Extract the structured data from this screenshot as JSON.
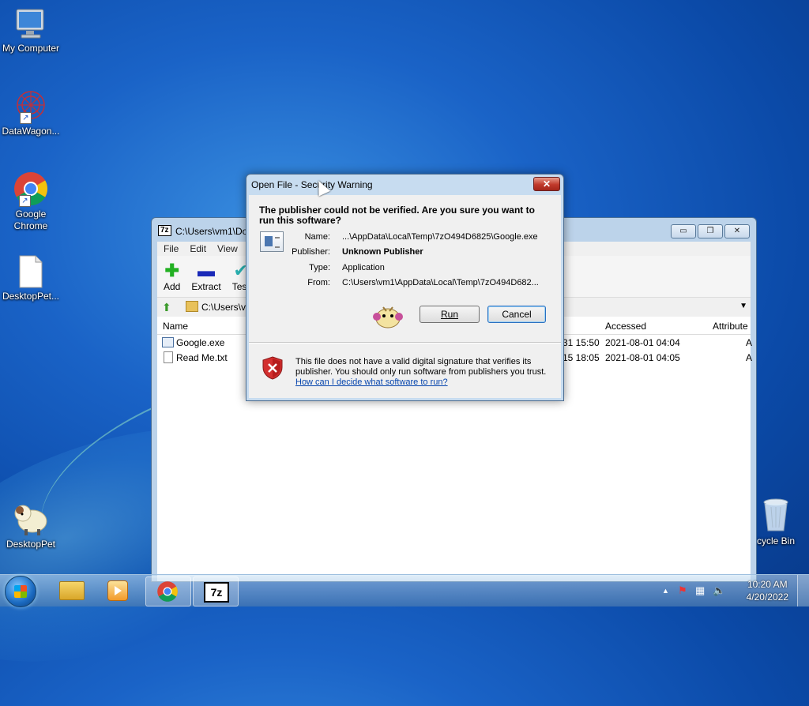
{
  "desktop": {
    "icons": [
      {
        "label": "My Computer"
      },
      {
        "label": "DataWagon..."
      },
      {
        "label": "Google Chrome"
      },
      {
        "label": "DesktopPet..."
      },
      {
        "label": "DesktopPet"
      },
      {
        "label": "cycle Bin"
      }
    ]
  },
  "zip_window": {
    "logo": "7z",
    "title": "C:\\Users\\vm1\\Do",
    "controls": {
      "minimize": "▭",
      "restore": "❐",
      "close": "✕"
    },
    "menu": [
      "File",
      "Edit",
      "View"
    ],
    "toolbar": [
      {
        "label": "Add"
      },
      {
        "label": "Extract"
      },
      {
        "label": "Test"
      }
    ],
    "address": "C:\\Users\\vi",
    "columns": {
      "name": "Name",
      "accessed": "Accessed",
      "attributes": "Attribute"
    },
    "rows": [
      {
        "name": "Google.exe",
        "modified": "31 15:50",
        "accessed": "2021-08-01 04:04",
        "attr": "A"
      },
      {
        "name": "Read Me.txt",
        "modified": "15 18:05",
        "accessed": "2021-08-01 04:05",
        "attr": "A"
      }
    ]
  },
  "dialog": {
    "title": "Open File - Security Warning",
    "heading": "The publisher could not be verified.  Are you sure you want to run this software?",
    "fields": [
      {
        "key": "Name:",
        "value": "...\\AppData\\Local\\Temp\\7zO494D6825\\Google.exe",
        "bold": false
      },
      {
        "key": "Publisher:",
        "value": "Unknown Publisher",
        "bold": true
      },
      {
        "key": "Type:",
        "value": "Application",
        "bold": false
      },
      {
        "key": "From:",
        "value": "C:\\Users\\vm1\\AppData\\Local\\Temp\\7zO494D682...",
        "bold": false
      }
    ],
    "run_button": "Run",
    "cancel_button": "Cancel",
    "warning_text": "This file does not have a valid digital signature that verifies its publisher.  You should only run software from publishers you trust.",
    "help_link": "How can I decide what software to run?"
  },
  "taskbar": {
    "time": "10:20 AM",
    "date": "4/20/2022",
    "pinned": [
      "explorer-icon",
      "media-player-icon",
      "chrome-icon",
      "7zip-icon"
    ]
  },
  "colors": {
    "desktop_blue": "#1a63c7",
    "dialog_frame": "#c7dcf0",
    "link_blue": "#0645ad",
    "close_red": "#c0392b"
  }
}
